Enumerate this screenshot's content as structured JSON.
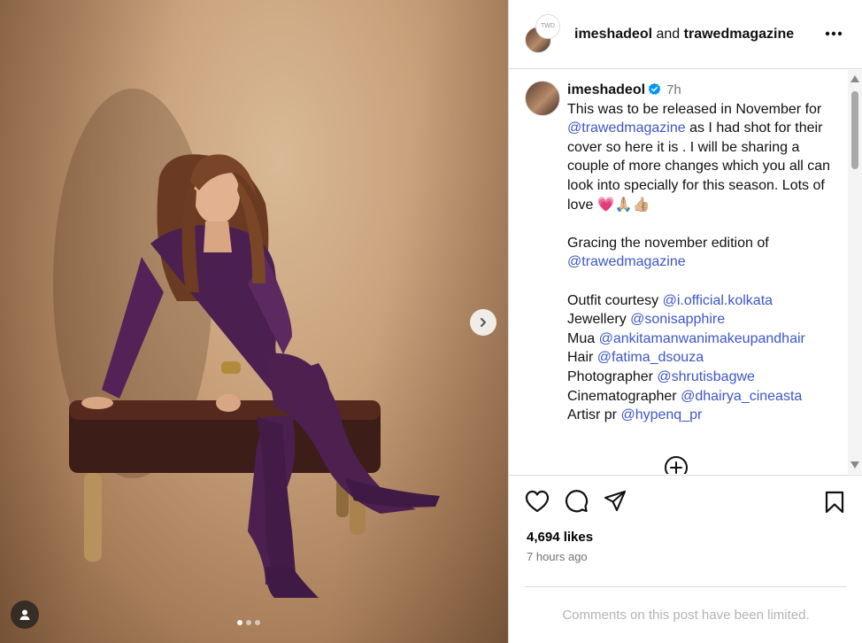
{
  "post": {
    "header_user1": "imeshadeol",
    "header_and": "and",
    "header_user2": "trawedmagazine",
    "collab_avatar_text": "TWD",
    "images": {
      "count": 3,
      "active": 0
    }
  },
  "caption": {
    "username": "imeshadeol",
    "time": "7h",
    "line1_pre": "This was to be released in November for ",
    "line1_mention": "@trawedmagazine",
    "line1_post": " as I had shot for their cover so here it is . I will be sharing a couple of more changes which you all can look into  specially for this season. Lots of love ",
    "emoji": "💗🙏🏼👍🏼",
    "line2_pre": "Gracing the november edition of",
    "line2_mention": "@trawedmagazine",
    "credits": [
      {
        "label": "Outfit courtesy ",
        "mention": "@i.official.kolkata"
      },
      {
        "label": "Jewellery ",
        "mention": "@sonisapphire"
      },
      {
        "label": "Mua ",
        "mention": "@ankitamanwanimakeupandhair"
      },
      {
        "label": "Hair ",
        "mention": "@fatima_dsouza"
      },
      {
        "label": "Photographer ",
        "mention": "@shrutisbagwe"
      },
      {
        "label": "Cinematographer ",
        "mention": "@dhairya_cineasta"
      },
      {
        "label": "Artisr pr ",
        "mention": "@hypenq_pr"
      }
    ]
  },
  "stats": {
    "likes": "4,694 likes",
    "posted": "7 hours ago"
  },
  "comments_notice": "Comments on this post have been limited.",
  "colors": {
    "mention": "#3d57c9",
    "verified": "#0095f6",
    "muted": "#737373"
  },
  "icons": [
    "more-icon",
    "verified-icon",
    "heart-icon",
    "comment-icon",
    "share-icon",
    "bookmark-icon",
    "plus-circle-icon",
    "chevron-right-icon",
    "user-tag-icon"
  ]
}
